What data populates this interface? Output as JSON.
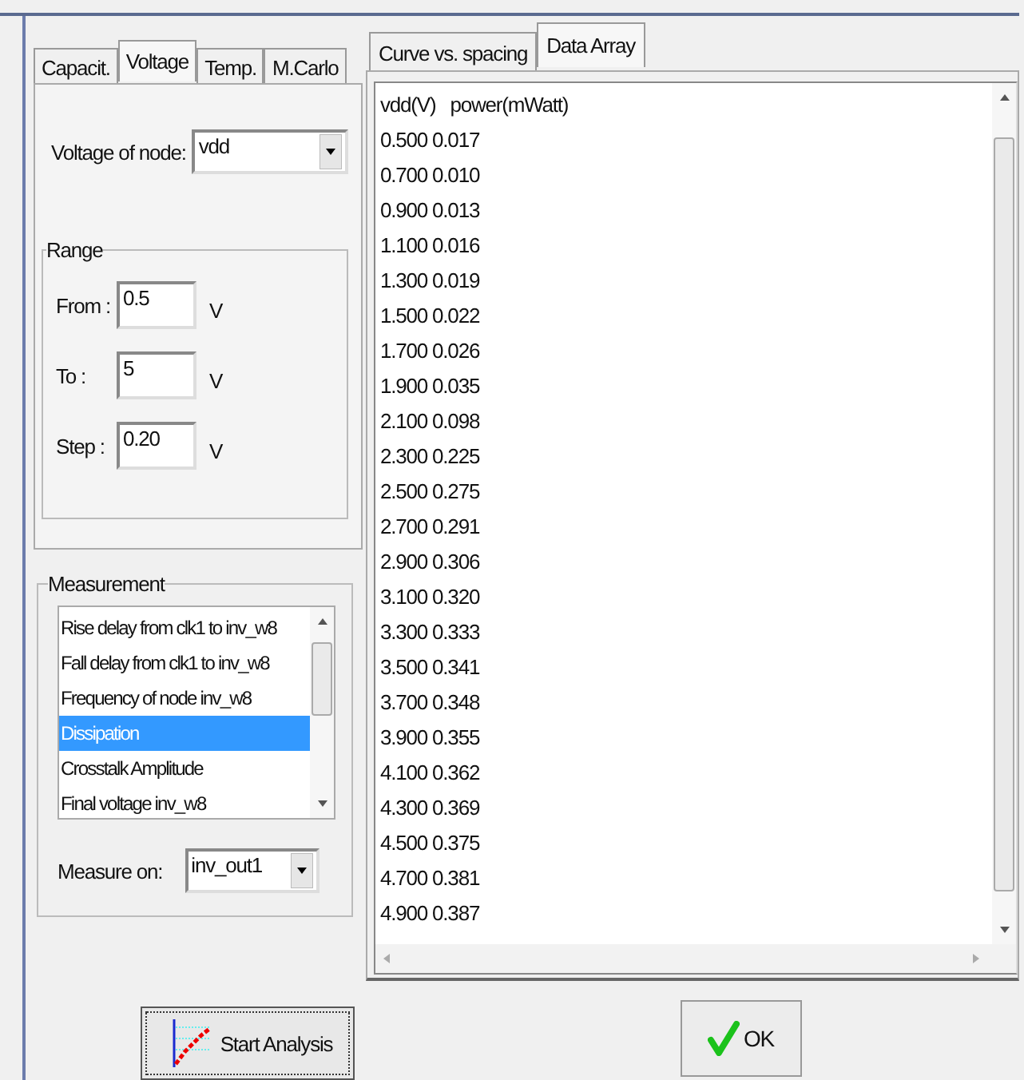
{
  "left_tabs": [
    {
      "label": "Capacit.",
      "selected": false
    },
    {
      "label": "Voltage",
      "selected": true
    },
    {
      "label": "Temp.",
      "selected": false
    },
    {
      "label": "M.Carlo",
      "selected": false
    }
  ],
  "voltage_of_node": {
    "label": "Voltage of node:",
    "value": "vdd"
  },
  "range": {
    "title": "Range",
    "fields": [
      {
        "label": "From :",
        "value": "0.5",
        "unit": "V"
      },
      {
        "label": "To :",
        "value": "5",
        "unit": "V"
      },
      {
        "label": "Step :",
        "value": "0.20",
        "unit": "V"
      }
    ]
  },
  "measurement": {
    "title": "Measurement",
    "items": [
      {
        "label": "Rise delay from clk1 to  inv_w8",
        "selected": false
      },
      {
        "label": "Fall delay from clk1 to  inv_w8",
        "selected": false
      },
      {
        "label": "Frequency of node  inv_w8",
        "selected": false
      },
      {
        "label": "Dissipation",
        "selected": true
      },
      {
        "label": "Crosstalk Amplitude",
        "selected": false
      },
      {
        "label": "Final voltage  inv_w8",
        "selected": false
      }
    ],
    "measure_on": {
      "label": "Measure on:",
      "value": "inv_out1"
    }
  },
  "start_button": "Start Analysis",
  "right_tabs": [
    {
      "label": "Curve vs. spacing",
      "selected": false
    },
    {
      "label": "Data Array",
      "selected": true
    }
  ],
  "data_array": {
    "header": "vdd(V)   power(mWatt)",
    "rows": [
      "0.500 0.017",
      "0.700 0.010",
      "0.900 0.013",
      "1.100 0.016",
      "1.300 0.019",
      "1.500 0.022",
      "1.700 0.026",
      "1.900 0.035",
      "2.100 0.098",
      "2.300 0.225",
      "2.500 0.275",
      "2.700 0.291",
      "2.900 0.306",
      "3.100 0.320",
      "3.300 0.333",
      "3.500 0.341",
      "3.700 0.348",
      "3.900 0.355",
      "4.100 0.362",
      "4.300 0.369",
      "4.500 0.375",
      "4.700 0.381",
      "4.900 0.387"
    ]
  },
  "ok_button": "OK"
}
